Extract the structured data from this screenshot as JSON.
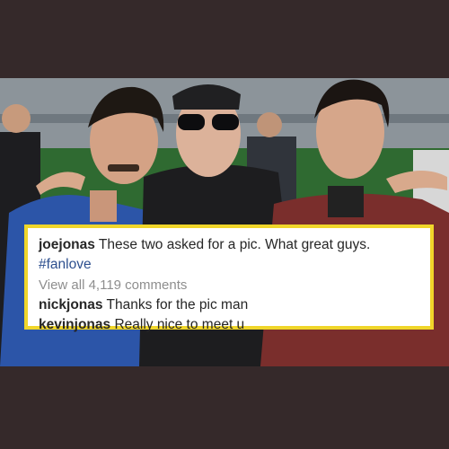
{
  "post": {
    "caption_user": "joejonas",
    "caption_text": "These two asked for a pic. What great guys.",
    "hashtag": "#fanlove",
    "view_all": "View all 4,119 comments"
  },
  "comments": [
    {
      "user": "nickjonas",
      "text": "Thanks for the pic man"
    },
    {
      "user": "kevinjonas",
      "text": "Really nice to meet u"
    }
  ],
  "colors": {
    "background": "#35292a",
    "highlight_border": "#f0d62a",
    "hashtag": "#2d4f8e",
    "muted_text": "#8e8e8e"
  }
}
